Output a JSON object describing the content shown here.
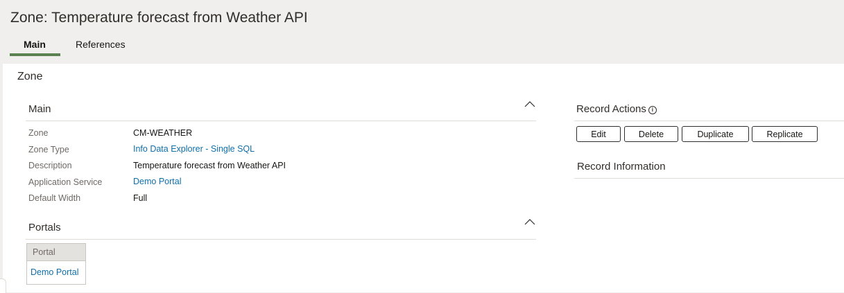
{
  "header": {
    "title": "Zone: Temperature forecast from Weather API",
    "tabs": [
      {
        "label": "Main",
        "active": true
      },
      {
        "label": "References",
        "active": false
      }
    ]
  },
  "zone_section": {
    "heading": "Zone",
    "main": {
      "title": "Main",
      "fields": [
        {
          "label": "Zone",
          "value": "CM-WEATHER",
          "link": false
        },
        {
          "label": "Zone Type",
          "value": "Info Data Explorer - Single SQL",
          "link": true
        },
        {
          "label": "Description",
          "value": "Temperature forecast from Weather API",
          "link": false
        },
        {
          "label": "Application Service",
          "value": "Demo Portal",
          "link": true
        },
        {
          "label": "Default Width",
          "value": "Full",
          "link": false
        }
      ]
    },
    "portals": {
      "title": "Portals",
      "column_header": "Portal",
      "rows": [
        "Demo Portal"
      ]
    }
  },
  "record_actions": {
    "title": "Record Actions",
    "info_icon": "i",
    "buttons": [
      "Edit",
      "Delete",
      "Duplicate",
      "Replicate"
    ]
  },
  "record_information": {
    "title": "Record Information"
  },
  "colors": {
    "accent_tab": "#5b8150",
    "link": "#0f6fa8",
    "header_bg": "#f1efed"
  }
}
